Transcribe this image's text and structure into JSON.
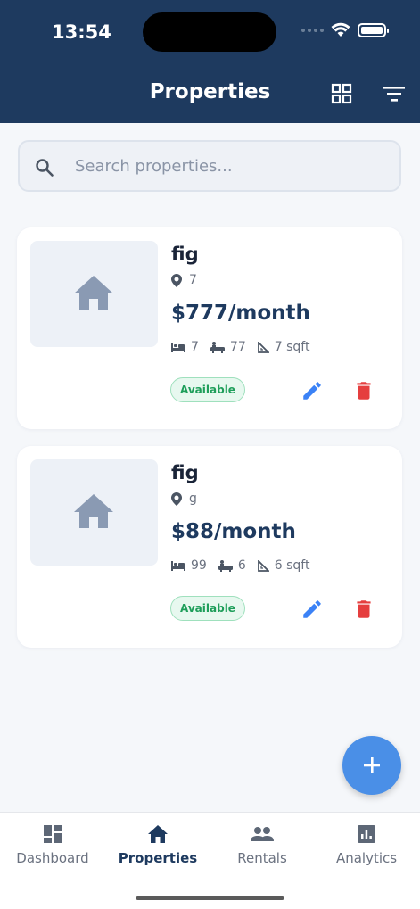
{
  "status_bar": {
    "time": "13:54"
  },
  "header": {
    "title": "Properties",
    "icons": [
      "grid-view-icon",
      "filter-icon"
    ]
  },
  "search": {
    "placeholder": "Search properties...",
    "value": ""
  },
  "properties": [
    {
      "name": "fig",
      "location": "7",
      "price": "$777/month",
      "beds": "7",
      "baths": "77",
      "area": "7 sqft",
      "status": "Available"
    },
    {
      "name": "fig",
      "location": "g",
      "price": "$88/month",
      "beds": "99",
      "baths": "6",
      "area": "6 sqft",
      "status": "Available"
    }
  ],
  "fab": {
    "icon": "plus-icon"
  },
  "tabs": [
    {
      "label": "Dashboard",
      "icon": "dashboard-icon",
      "active": false
    },
    {
      "label": "Properties",
      "icon": "home-icon",
      "active": true
    },
    {
      "label": "Rentals",
      "icon": "people-icon",
      "active": false
    },
    {
      "label": "Analytics",
      "icon": "analytics-icon",
      "active": false
    }
  ],
  "colors": {
    "header": "#1e3a5f",
    "accent": "#4a8fe7",
    "available": "#1e9e5a",
    "delete": "#e53e3e",
    "edit": "#3b82f6"
  }
}
